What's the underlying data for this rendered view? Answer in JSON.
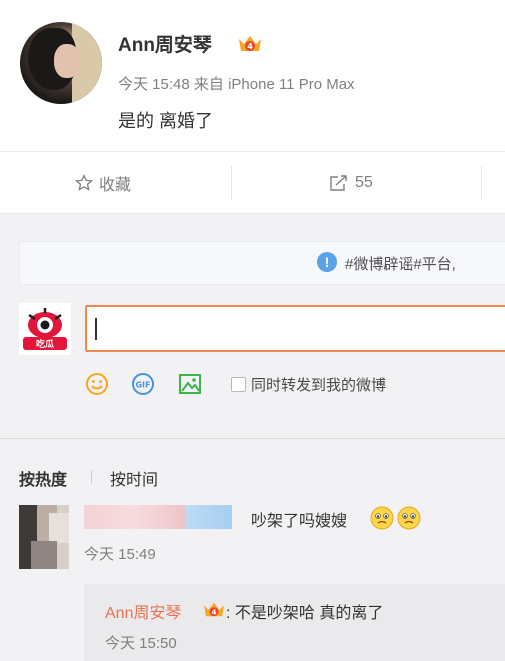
{
  "post": {
    "username": "Ann周安琴",
    "time": "今天 15:48",
    "source_prefix": "来自",
    "source_device": "iPhone 11 Pro Max",
    "content": "是的 离婚了"
  },
  "actions": {
    "favorite_label": "收藏",
    "repost_count": "55"
  },
  "notice": {
    "text": "#微博辟谣#平台,"
  },
  "composer": {
    "input_value": "",
    "repost_checkbox_label": "同时转发到我的微博"
  },
  "sort": {
    "hot_label": "按热度",
    "time_label": "按时间"
  },
  "comments": [
    {
      "text": "吵架了吗嫂嫂",
      "time": "今天 15:49",
      "reply": {
        "author": "Ann周安琴",
        "separator": ":",
        "text": "不是吵架哈 真的离了",
        "time": "今天 15:50"
      }
    }
  ],
  "colors": {
    "accent_orange": "#f28a4c",
    "reply_author": "#eb7350",
    "info_blue": "#5aa2e6"
  }
}
